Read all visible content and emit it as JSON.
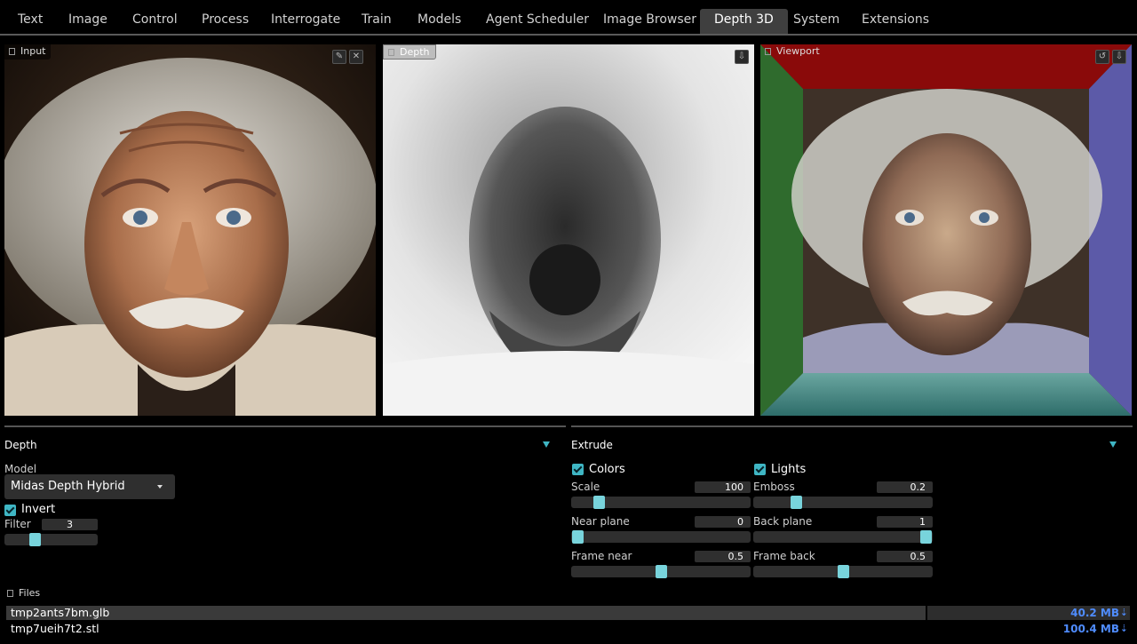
{
  "tabs": [
    {
      "label": "Text",
      "active": false
    },
    {
      "label": "Image",
      "active": false
    },
    {
      "label": "Control",
      "active": false
    },
    {
      "label": "Process",
      "active": false
    },
    {
      "label": "Interrogate",
      "active": false
    },
    {
      "label": "Train",
      "active": false
    },
    {
      "label": "Models",
      "active": false
    },
    {
      "label": "Agent Scheduler",
      "active": false
    },
    {
      "label": "Image Browser",
      "active": false
    },
    {
      "label": "Depth 3D",
      "active": true
    },
    {
      "label": "System",
      "active": false
    },
    {
      "label": "Extensions",
      "active": false
    }
  ],
  "panels": {
    "input": {
      "label": "Input",
      "controls": [
        "edit-icon",
        "close-icon"
      ]
    },
    "depth": {
      "label": "Depth",
      "controls": [
        "download-icon"
      ]
    },
    "viewport": {
      "label": "Viewport",
      "controls": [
        "reset-icon",
        "download-icon"
      ]
    }
  },
  "depth_section": {
    "title": "Depth",
    "model_label": "Model",
    "model_value": "Midas Depth Hybrid",
    "invert_label": "Invert",
    "invert_checked": true,
    "filter_label": "Filter",
    "filter_value": "3",
    "filter_fraction": 0.3
  },
  "extrude_section": {
    "title": "Extrude",
    "colors_label": "Colors",
    "colors_checked": true,
    "lights_label": "Lights",
    "lights_checked": true,
    "scale_label": "Scale",
    "scale_value": "100",
    "scale_fraction": 0.13,
    "emboss_label": "Emboss",
    "emboss_value": "0.2",
    "emboss_fraction": 0.22,
    "near_plane_label": "Near plane",
    "near_plane_value": "0",
    "near_plane_fraction": 0.0,
    "back_plane_label": "Back plane",
    "back_plane_value": "1",
    "back_plane_fraction": 1.0,
    "frame_near_label": "Frame near",
    "frame_near_value": "0.5",
    "frame_near_fraction": 0.5,
    "frame_back_label": "Frame back",
    "frame_back_value": "0.5",
    "frame_back_fraction": 0.5
  },
  "files": {
    "title": "Files",
    "items": [
      {
        "name": "tmp2ants7bm.glb",
        "size": "40.2 MB",
        "progress": 0.82
      },
      {
        "name": "tmp7ueih7t2.stl",
        "size": "100.4 MB",
        "progress": 0
      }
    ]
  },
  "colors": {
    "accent": "#3fb6c4",
    "thumb": "#78d4dc",
    "link": "#4f8cff",
    "active_tab": "#3f3f3f"
  }
}
